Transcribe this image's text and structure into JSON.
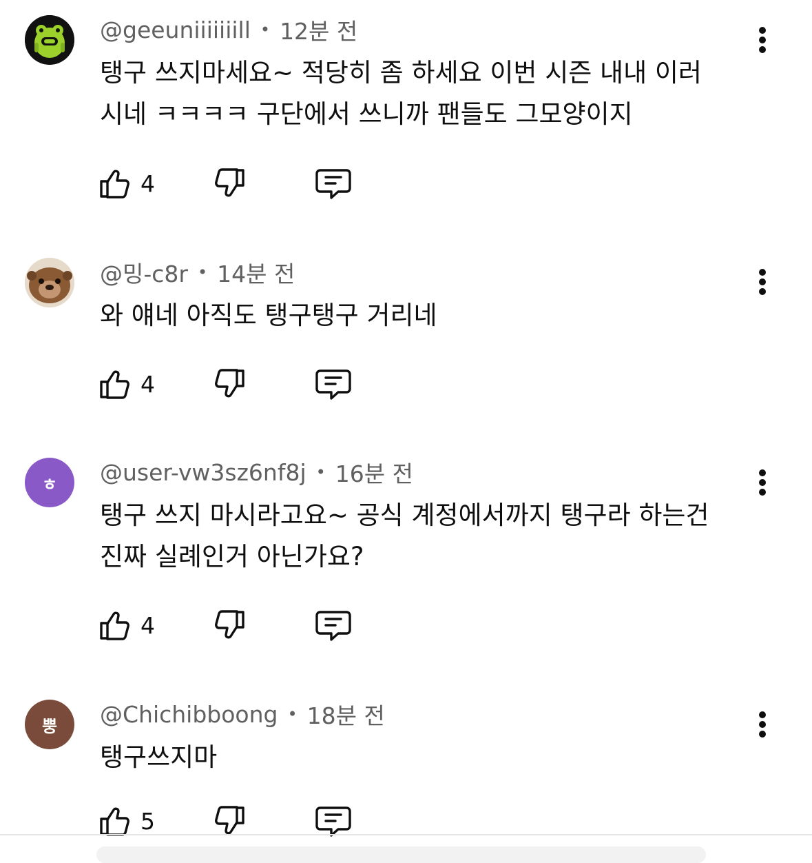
{
  "colors": {
    "avatar_3_bg": "#8a59c8",
    "avatar_4_bg": "#7a4b3b",
    "meta_text": "#606060",
    "body_text": "#0f0f0f"
  },
  "comments": [
    {
      "handle": "@geeuniiiiiiill",
      "separator": "•",
      "time": "12분 전",
      "text": "탱구 쓰지마세요~ 적당히 좀 하세요 이번 시즌 내내 이러\n시네 ㅋㅋㅋㅋ 구단에서 쓰니까 팬들도 그모양이지",
      "likes": "4",
      "avatar_icon": "green-frog-avatar-icon"
    },
    {
      "handle": "@밍-c8r",
      "separator": "•",
      "time": "14분 전",
      "text": "와 얘네 아직도 탱구탱구 거리네",
      "likes": "4",
      "avatar_icon": "otter-photo-avatar-icon"
    },
    {
      "handle": "@user-vw3sz6nf8j",
      "separator": "•",
      "time": "16분 전",
      "text": "탱구 쓰지 마시라고요~ 공식 계정에서까지 탱구라 하는건\n진짜 실례인거 아닌가요?",
      "likes": "4",
      "avatar_letter": "ㅎ"
    },
    {
      "handle": "@Chichibboong",
      "separator": "•",
      "time": "18분 전",
      "text": "탱구쓰지마",
      "likes": "5",
      "avatar_letter": "뿡"
    }
  ],
  "icons": {
    "like": "thumbs-up-icon",
    "dislike": "thumbs-down-icon",
    "reply": "comment-bubble-icon",
    "more": "more-vertical-icon"
  }
}
